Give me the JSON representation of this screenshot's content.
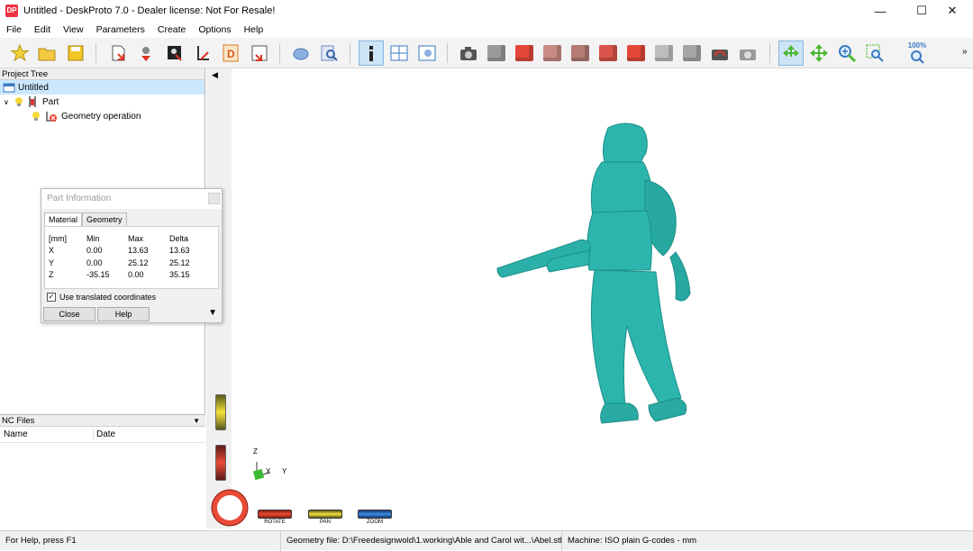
{
  "window": {
    "title": "Untitled - DeskProto 7.0 - Dealer license: Not For Resale!",
    "logo": "DP",
    "controls": [
      "minimize-icon",
      "maximize-icon",
      "close-icon"
    ]
  },
  "menu": [
    "File",
    "Edit",
    "View",
    "Parameters",
    "Create",
    "Options",
    "Help"
  ],
  "toolbar": {
    "zoom_label": "100%"
  },
  "project_tree": {
    "header": "Project Tree",
    "items": [
      {
        "label": "Untitled",
        "level": 0,
        "selected": true
      },
      {
        "label": "Part",
        "level": 1,
        "selected": false
      },
      {
        "label": "Geometry operation",
        "level": 2,
        "selected": false
      }
    ]
  },
  "nc_files": {
    "header": "NC Files",
    "columns": [
      "Name",
      "Date"
    ]
  },
  "part_information": {
    "title": "Part Information",
    "tabs": [
      "Material",
      "Geometry"
    ],
    "active_tab": "Material",
    "table": {
      "headers": [
        "[mm]",
        "Min",
        "Max",
        "Delta"
      ],
      "rows": [
        [
          "X",
          "0.00",
          "13.63",
          "13.63"
        ],
        [
          "Y",
          "0.00",
          "25.12",
          "25.12"
        ],
        [
          "Z",
          "-35.15",
          "0.00",
          "35.15"
        ]
      ]
    },
    "checkbox_label": "Use translated coordinates",
    "checkbox_checked": true,
    "close_label": "Close",
    "help_label": "Help"
  },
  "viewport": {
    "axis_labels": {
      "z": "Z",
      "x": "X",
      "y": "Y"
    },
    "controls": {
      "rotate": "ROTATE",
      "pan": "PAN",
      "zoom": "ZOOM"
    },
    "model_color": "#2bb5ad"
  },
  "status": {
    "help": "For Help, press F1",
    "geometry": "Geometry file: D:\\Freedesignwold\\1.working\\Able and Carol wit...\\Abel.stl",
    "machine": "Machine: ISO plain G-codes - mm"
  }
}
